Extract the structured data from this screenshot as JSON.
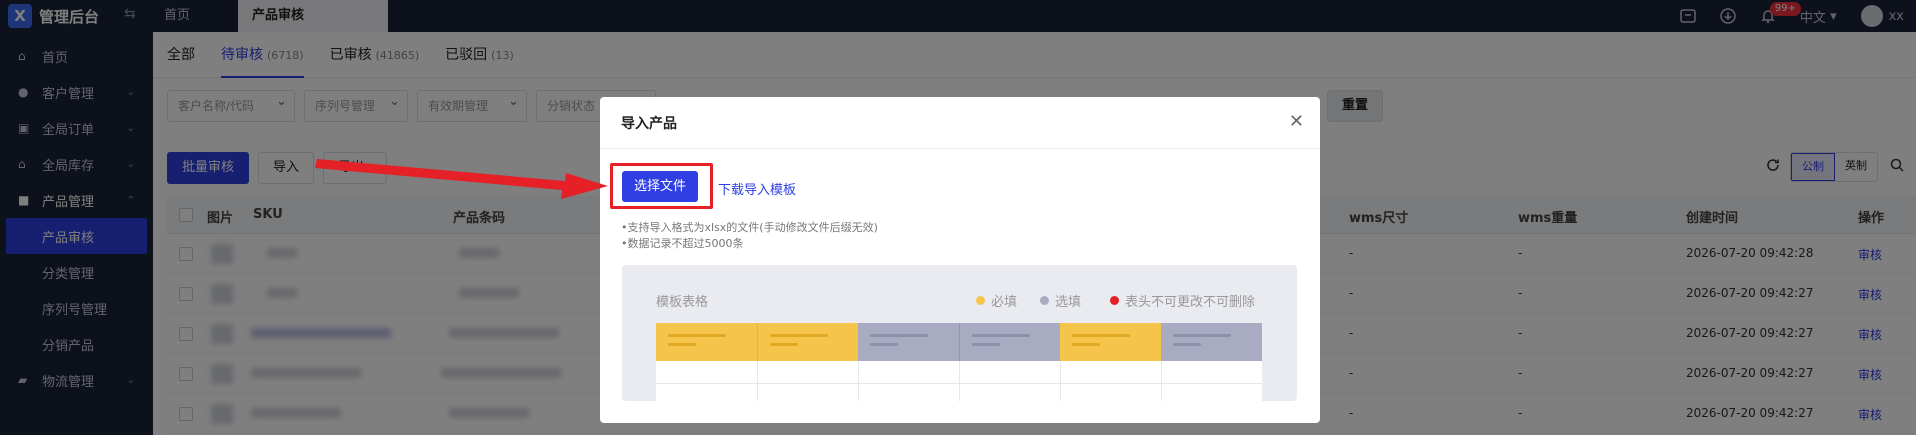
{
  "app": {
    "title": "管理后台",
    "logo_letter": "X"
  },
  "tabs": [
    {
      "label": "首页"
    },
    {
      "label": "产品审核"
    }
  ],
  "topbar": {
    "badge": "99+",
    "language": "中文",
    "user": "xx"
  },
  "sidebar": {
    "items": [
      {
        "label": "首页",
        "icon": "home-icon"
      },
      {
        "label": "客户管理",
        "icon": "users-icon"
      },
      {
        "label": "全局订单",
        "icon": "clipboard-icon"
      },
      {
        "label": "全局库存",
        "icon": "warehouse-icon"
      },
      {
        "label": "产品管理",
        "icon": "box-icon"
      }
    ],
    "sub_items": [
      {
        "label": "产品审核"
      },
      {
        "label": "分类管理"
      },
      {
        "label": "序列号管理"
      },
      {
        "label": "分销产品"
      }
    ],
    "last_item": {
      "label": "物流管理",
      "icon": "truck-icon"
    }
  },
  "status_tabs": [
    {
      "label": "全部",
      "count": ""
    },
    {
      "label": "待审核",
      "count": "(6718)"
    },
    {
      "label": "已审核",
      "count": "(41865)"
    },
    {
      "label": "已驳回",
      "count": "(13)"
    }
  ],
  "filters": [
    "客户名称/代码",
    "序列号管理",
    "有效期管理",
    "分销状态"
  ],
  "reset_label": "重置",
  "toolbar": {
    "batch_label": "批量审核",
    "import_label": "导入",
    "export_label": "导出"
  },
  "unit_toggle": [
    "公制",
    "英制"
  ],
  "table": {
    "headers": [
      "图片",
      "SKU",
      "产品条码",
      "wms尺寸",
      "wms重量",
      "创建时间",
      "操作"
    ],
    "rows": [
      {
        "dim": "-",
        "weight": "-",
        "created": "2026-07-20 09:42:28",
        "action": "审核"
      },
      {
        "dim": "-",
        "weight": "-",
        "created": "2026-07-20 09:42:27",
        "action": "审核"
      },
      {
        "dim": "-",
        "weight": "-",
        "created": "2026-07-20 09:42:27",
        "action": "审核"
      },
      {
        "dim": "-",
        "weight": "-",
        "created": "2026-07-20 09:42:27",
        "action": "审核"
      },
      {
        "dim": "-",
        "weight": "-",
        "created": "2026-07-20 09:42:27",
        "action": "审核"
      }
    ]
  },
  "modal": {
    "title": "导入产品",
    "choose_label": "选择文件",
    "download_label": "下载导入模板",
    "tips": [
      "•支持导入格式为xlsx的文件(手动修改文件后缀无效)",
      "•数据记录不超过5000条"
    ],
    "template_title": "模板表格",
    "legend": [
      {
        "label": "必填",
        "color": "#f5c44a"
      },
      {
        "label": "选填",
        "color": "#a9abc3"
      },
      {
        "label": "表头不可更改不可删除",
        "color": "#e52027"
      }
    ]
  },
  "colors": {
    "primary": "#2f3fe3",
    "sidebar": "#1b2337",
    "required": "#f5c44a",
    "optional": "#a9abc3",
    "annotation": "#e52027"
  }
}
